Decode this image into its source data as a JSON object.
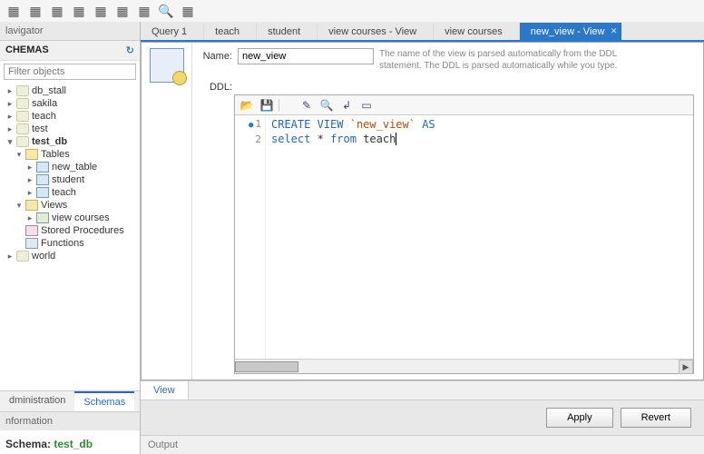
{
  "nav_header": "lavigator",
  "schemas_header": "CHEMAS",
  "filter_placeholder": "Filter objects",
  "tree": {
    "db_stall": "db_stall",
    "sakila": "sakila",
    "teach": "teach",
    "test": "test",
    "test_db": "test_db",
    "tables": "Tables",
    "new_table": "new_table",
    "student": "student",
    "teach_tbl": "teach",
    "views": "Views",
    "view_courses": "view courses",
    "stored_procs": "Stored Procedures",
    "functions": "Functions",
    "world": "world"
  },
  "side_tabs": {
    "administration": "dministration",
    "schemas": "Schemas"
  },
  "info_header": "nformation",
  "schema_label": "Schema:",
  "schema_value": "test_db",
  "tabs": [
    "Query 1",
    "teach",
    "student",
    "view courses - View",
    "view courses",
    "new_view - View"
  ],
  "form": {
    "name_label": "Name:",
    "name_value": "new_view",
    "ddl_label": "DDL:",
    "hint_line1": "The name of the view is parsed automatically from the DDL",
    "hint_line2": "statement. The DDL is parsed automatically while you type."
  },
  "code": {
    "ln1": "1",
    "ln2": "2",
    "line1_kw1": "CREATE VIEW",
    "line1_id": "`new_view`",
    "line1_kw2": "AS",
    "line2_kw1": "select",
    "line2_txt1": "*",
    "line2_kw2": "from",
    "line2_txt2": "teach"
  },
  "view_tab": "View",
  "apply": "Apply",
  "revert": "Revert",
  "output": "Output"
}
